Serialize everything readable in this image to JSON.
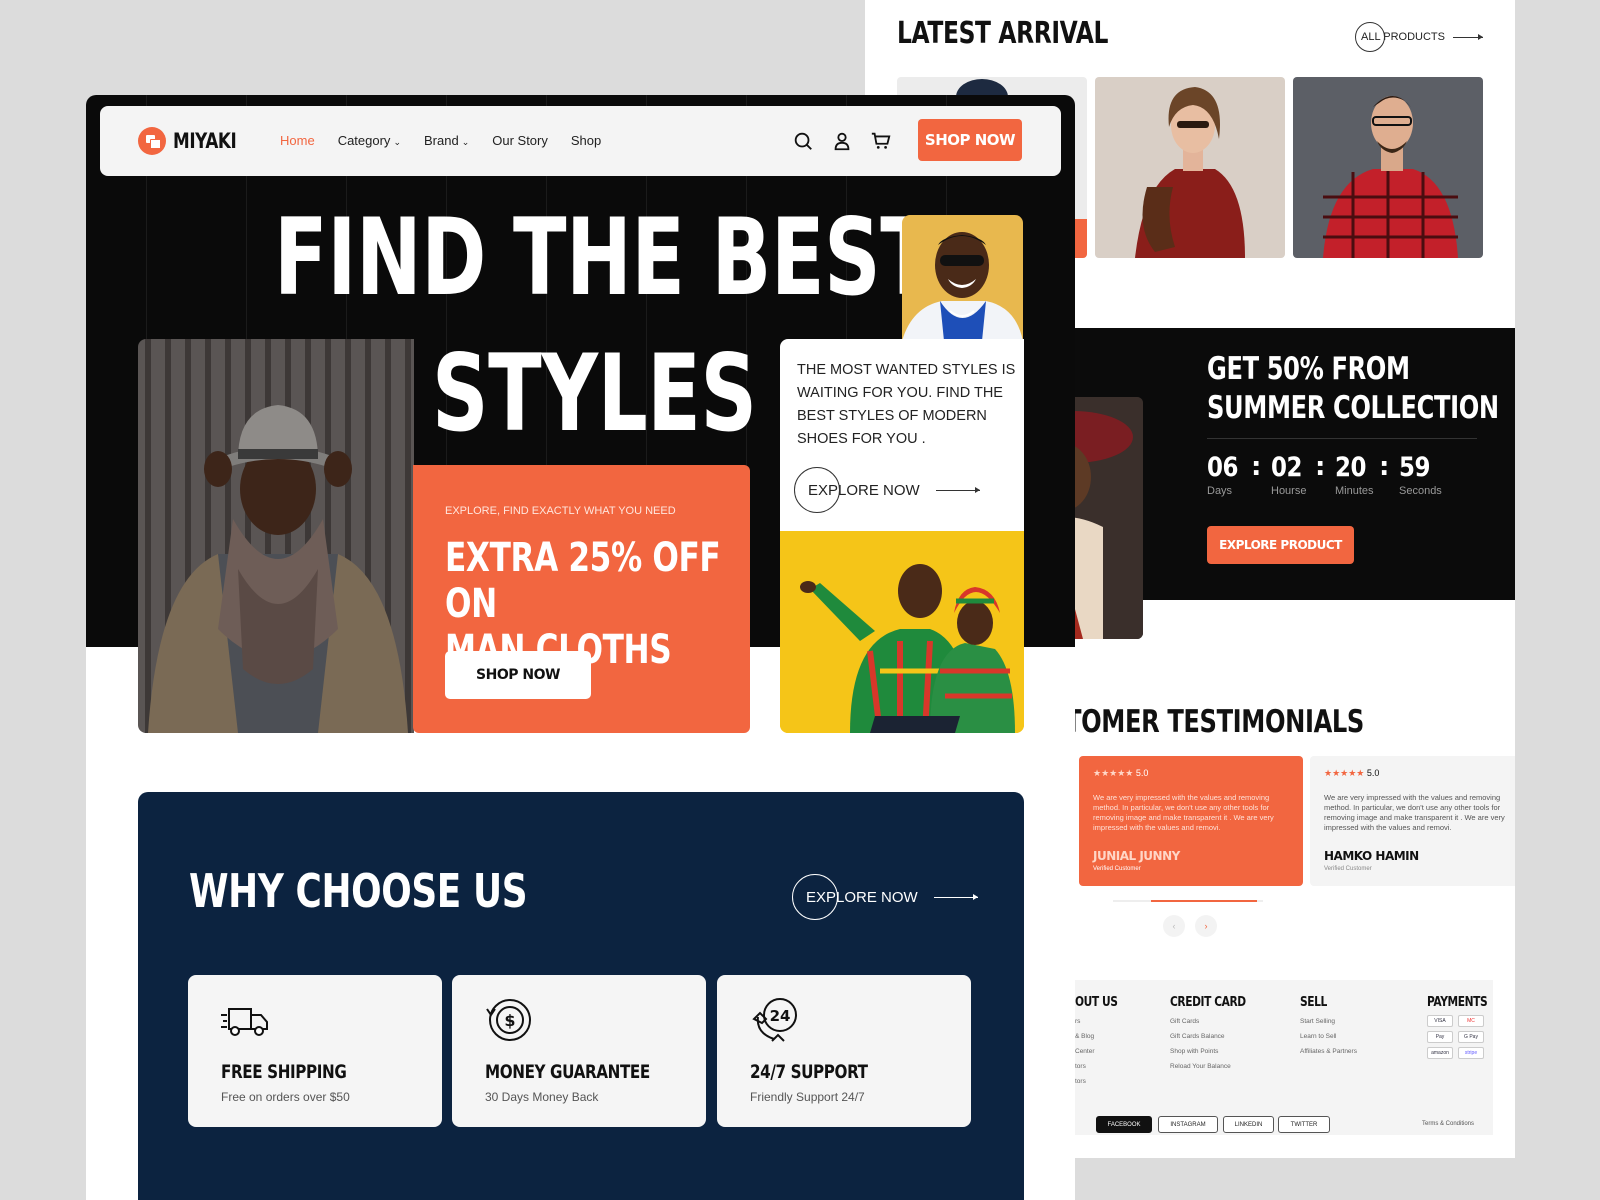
{
  "colors": {
    "accent": "#f26640",
    "dark": "#0a0a0a",
    "navy": "#0c2340",
    "yellow": "#f5c518"
  },
  "back": {
    "latest_arrival": {
      "title": "LATEST ARRIVAL",
      "all_products": "ALL PRODUCTS"
    },
    "summer": {
      "title_line1": "GET 50% FROM",
      "title_line2": "SUMMER COLLECTION",
      "countdown": [
        {
          "value": "06",
          "label": "Days"
        },
        {
          "value": "02",
          "label": "Hourse"
        },
        {
          "value": "20",
          "label": "Minutes"
        },
        {
          "value": "59",
          "label": "Seconds"
        }
      ],
      "separator": ":",
      "button": "EXPLORE PRODUCT"
    },
    "testimonials": {
      "title": "TOMER TESTIMONIALS",
      "cards": [
        {
          "stars": "★★★★★",
          "rating": "5.0",
          "text": "We are very impressed with the values and removing method. In particular, we don't use any other tools for removing image and make transparent it . We are very impressed with the values and removi.",
          "name": "JUNIAL JUNNY",
          "role": "Verified Customer"
        },
        {
          "stars": "★★★★★",
          "rating": "5.0",
          "text": "We are very impressed with the values and removing method. In particular, we don't use any other tools for removing image and make transparent it . We are very impressed with the values and removi.",
          "name": "HAMKO HAMIN",
          "role": "Verified Customer"
        }
      ],
      "prev": "‹",
      "next": "›"
    },
    "footer": {
      "about": {
        "heading": "OUT US",
        "items": [
          "rs",
          "& Blog",
          "Center",
          "tors",
          "tors"
        ]
      },
      "credit": {
        "heading": "CREDIT CARD",
        "items": [
          "Gift Cards",
          "Gift Cards Balance",
          "Shop with Points",
          "Reload Your Balance"
        ]
      },
      "sell": {
        "heading": "SELL",
        "items": [
          "Start Selling",
          "Learn to Sell",
          "Affiliates & Partners"
        ]
      },
      "payments": {
        "heading": "PAYMENTS",
        "methods": [
          "VISA",
          "MC",
          "Pay",
          "G Pay",
          "amazon",
          "stripe"
        ]
      },
      "social": [
        "FACEBOOK",
        "INSTAGRAM",
        "LINKEDIN",
        "TWITTER"
      ],
      "terms": "Terms & Conditions"
    }
  },
  "front": {
    "brand": "MIYAKI",
    "nav": [
      {
        "label": "Home",
        "caret": ""
      },
      {
        "label": "Category",
        "caret": "⌄"
      },
      {
        "label": "Brand",
        "caret": "⌄"
      },
      {
        "label": "Our Story",
        "caret": ""
      },
      {
        "label": "Shop",
        "caret": ""
      }
    ],
    "shop_now": "SHOP NOW",
    "hero": {
      "line1": "FIND THE BEST",
      "line2": "STYLES"
    },
    "promo": {
      "subtitle": "EXPLORE, FIND EXACTLY WHAT YOU NEED",
      "title_line1": "EXTRA 25% OFF ON",
      "title_line2": "MAN CLOTHS",
      "button": "SHOP NOW"
    },
    "side_text": "THE MOST WANTED STYLES IS WAITING FOR YOU. FIND THE BEST STYLES OF MODERN SHOES FOR YOU .",
    "explore_now": "EXPLORE NOW",
    "why": {
      "title": "WHY CHOOSE US",
      "explore_now": "EXPLORE NOW",
      "features": [
        {
          "title": "FREE SHIPPING",
          "subtitle": "Free on orders over $50",
          "icon": "truck-icon"
        },
        {
          "title": "MONEY GUARANTEE",
          "subtitle": "30 Days Money Back",
          "icon": "money-back-icon"
        },
        {
          "title": "24/7 SUPPORT",
          "subtitle": "Friendly Support 24/7",
          "icon": "support-24-icon"
        }
      ]
    }
  }
}
